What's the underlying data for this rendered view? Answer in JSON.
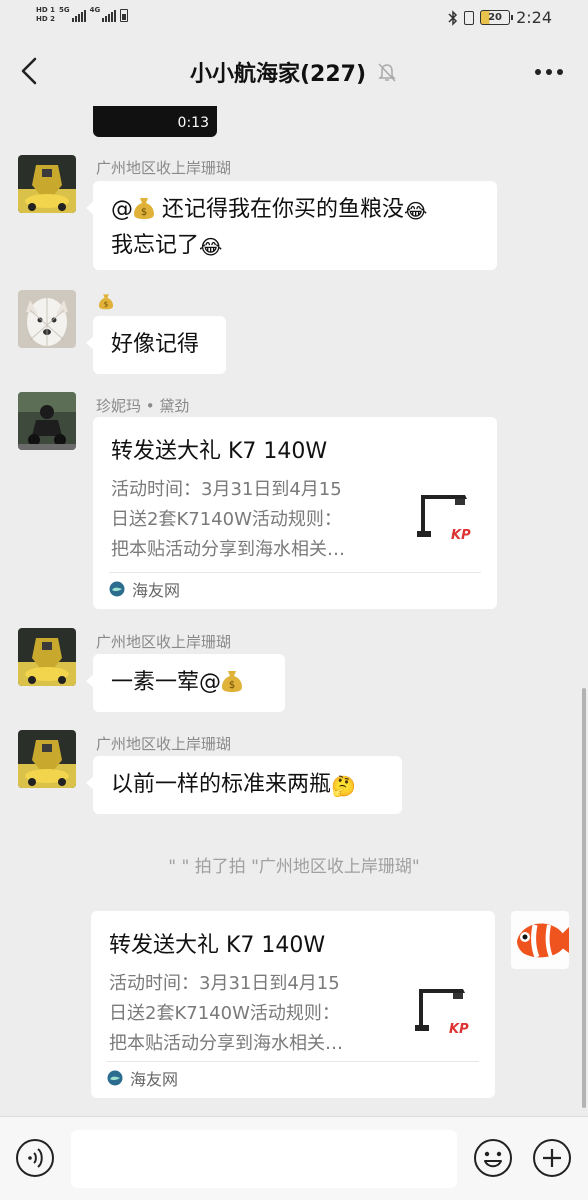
{
  "status_bar": {
    "hd1": "HD 1",
    "hd2": "HD 2",
    "net1": "5G",
    "net2": "4G",
    "battery_level": "20",
    "time": "2:24"
  },
  "header": {
    "title": "小小航海家(227)",
    "icons": [
      "back-icon",
      "mute-icon",
      "more-icon"
    ]
  },
  "video_stub": {
    "duration": "0:13"
  },
  "messages": [
    {
      "sender": "广州地区收上岸珊瑚",
      "text_part1": "@",
      "text_part2": " 还记得我在你买的鱼粮没",
      "emoji_after": "😂",
      "text_line2": "我忘记了",
      "emoji_end": "😂"
    },
    {
      "sender_icon": "money-bag-icon",
      "text": "好像记得"
    },
    {
      "sender": "珍妮玛 • 黛劲",
      "card": {
        "title": "转发送大礼 K7 140W",
        "desc_line1": "活动时间：3月31日到4月15",
        "desc_line2": "日送2套K7140W活动规则：",
        "desc_line3": "把本贴活动分享到海水相关…",
        "source": "海友网"
      }
    },
    {
      "sender": "广州地区收上岸珊瑚",
      "text": "一素一荤@"
    },
    {
      "sender": "广州地区收上岸珊瑚",
      "text": "以前一样的标准来两瓶",
      "emoji": "🤔"
    }
  ],
  "system_message": "\" \" 拍了拍 \"广州地区收上岸珊瑚\"",
  "my_card": {
    "title": "转发送大礼 K7 140W",
    "desc_line1": "活动时间：3月31日到4月15",
    "desc_line2": "日送2套K7140W活动规则：",
    "desc_line3": "把本贴活动分享到海水相关…",
    "source": "海友网"
  },
  "input_bar": {
    "placeholder": "",
    "icons": [
      "voice-icon",
      "emoji-icon",
      "plus-icon"
    ]
  },
  "colors": {
    "background": "#ededed",
    "bubble": "#ffffff",
    "sender_gray": "#8a8a8a"
  }
}
